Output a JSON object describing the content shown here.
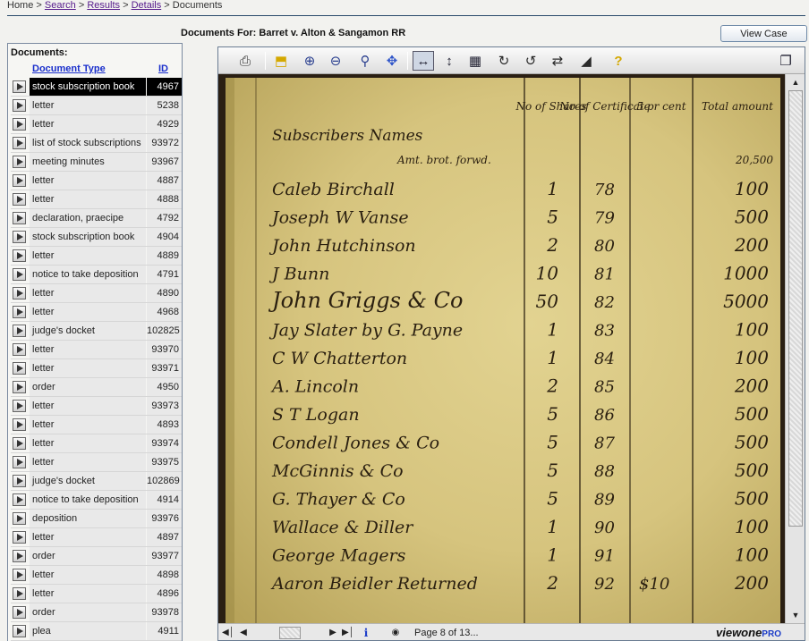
{
  "breadcrumb": {
    "home": "Home",
    "sep1": ">",
    "search": "Search",
    "sep2": ">",
    "results": "Results",
    "sep3": ">",
    "details": "Details",
    "sep4": ">",
    "current": "Documents"
  },
  "header": {
    "title": "Documents For: Barret v. Alton & Sangamon RR",
    "view_case_label": "View Case"
  },
  "left_panel": {
    "label": "Documents:",
    "col_type": "Document Type",
    "col_id": "ID",
    "rows": [
      {
        "type": "stock subscription book",
        "id": "4967"
      },
      {
        "type": "letter",
        "id": "5238"
      },
      {
        "type": "letter",
        "id": "4929"
      },
      {
        "type": "list of stock subscriptions",
        "id": "93972"
      },
      {
        "type": "meeting minutes",
        "id": "93967"
      },
      {
        "type": "letter",
        "id": "4887"
      },
      {
        "type": "letter",
        "id": "4888"
      },
      {
        "type": "declaration, praecipe",
        "id": "4792"
      },
      {
        "type": "stock subscription book",
        "id": "4904"
      },
      {
        "type": "letter",
        "id": "4889"
      },
      {
        "type": "notice to take deposition",
        "id": "4791"
      },
      {
        "type": "letter",
        "id": "4890"
      },
      {
        "type": "letter",
        "id": "4968"
      },
      {
        "type": "judge's docket",
        "id": "102825"
      },
      {
        "type": "letter",
        "id": "93970"
      },
      {
        "type": "letter",
        "id": "93971"
      },
      {
        "type": "order",
        "id": "4950"
      },
      {
        "type": "letter",
        "id": "93973"
      },
      {
        "type": "letter",
        "id": "4893"
      },
      {
        "type": "letter",
        "id": "93974"
      },
      {
        "type": "letter",
        "id": "93975"
      },
      {
        "type": "judge's docket",
        "id": "102869"
      },
      {
        "type": "notice to take deposition",
        "id": "4914"
      },
      {
        "type": "deposition",
        "id": "93976"
      },
      {
        "type": "letter",
        "id": "4897"
      },
      {
        "type": "order",
        "id": "93977"
      },
      {
        "type": "letter",
        "id": "4898"
      },
      {
        "type": "letter",
        "id": "4896"
      },
      {
        "type": "order",
        "id": "93978"
      },
      {
        "type": "plea",
        "id": "4911"
      }
    ]
  },
  "viewer": {
    "page_indicator": "Page 8 of 13...",
    "brand_main": "viewone",
    "brand_pro": "PRO",
    "help_glyph": "?",
    "info_glyph": "i"
  },
  "ledger": {
    "headers": [
      "No of Shares",
      "No of Certificate",
      "5 pr cent",
      "Total amount"
    ],
    "subscribers_heading": "Subscribers Names",
    "carried_forward": "Amt. brot. forwd.",
    "carried_amount": "20,500",
    "entries": [
      {
        "name": "Caleb Birchall",
        "shares": "1",
        "cert": "78",
        "pct": "",
        "amount": "100"
      },
      {
        "name": "Joseph W Vanse",
        "shares": "5",
        "cert": "79",
        "pct": "",
        "amount": "500"
      },
      {
        "name": "John Hutchinson",
        "shares": "2",
        "cert": "80",
        "pct": "",
        "amount": "200"
      },
      {
        "name": "J Bunn",
        "shares": "10",
        "cert": "81",
        "pct": "",
        "amount": "1000"
      },
      {
        "name": "John Griggs & Co",
        "shares": "50",
        "cert": "82",
        "pct": "",
        "amount": "5000"
      },
      {
        "name": "Jay Slater by G. Payne",
        "shares": "1",
        "cert": "83",
        "pct": "",
        "amount": "100"
      },
      {
        "name": "C W Chatterton",
        "shares": "1",
        "cert": "84",
        "pct": "",
        "amount": "100"
      },
      {
        "name": "A. Lincoln",
        "shares": "2",
        "cert": "85",
        "pct": "",
        "amount": "200"
      },
      {
        "name": "S T Logan",
        "shares": "5",
        "cert": "86",
        "pct": "",
        "amount": "500"
      },
      {
        "name": "Condell Jones & Co",
        "shares": "5",
        "cert": "87",
        "pct": "",
        "amount": "500"
      },
      {
        "name": "McGinnis & Co",
        "shares": "5",
        "cert": "88",
        "pct": "",
        "amount": "500"
      },
      {
        "name": "G. Thayer & Co",
        "shares": "5",
        "cert": "89",
        "pct": "",
        "amount": "500"
      },
      {
        "name": "Wallace & Diller",
        "shares": "1",
        "cert": "90",
        "pct": "",
        "amount": "100"
      },
      {
        "name": "George Magers",
        "shares": "1",
        "cert": "91",
        "pct": "",
        "amount": "100"
      },
      {
        "name": "Aaron Beidler Returned",
        "shares": "2",
        "cert": "92",
        "pct": "$10",
        "amount": "200"
      }
    ]
  },
  "colors": {
    "link": "#551a8b",
    "header_link": "#1a2fcc",
    "selected_row_bg": "#000000",
    "paper": "#d7c783",
    "ink": "#2a1f10"
  }
}
